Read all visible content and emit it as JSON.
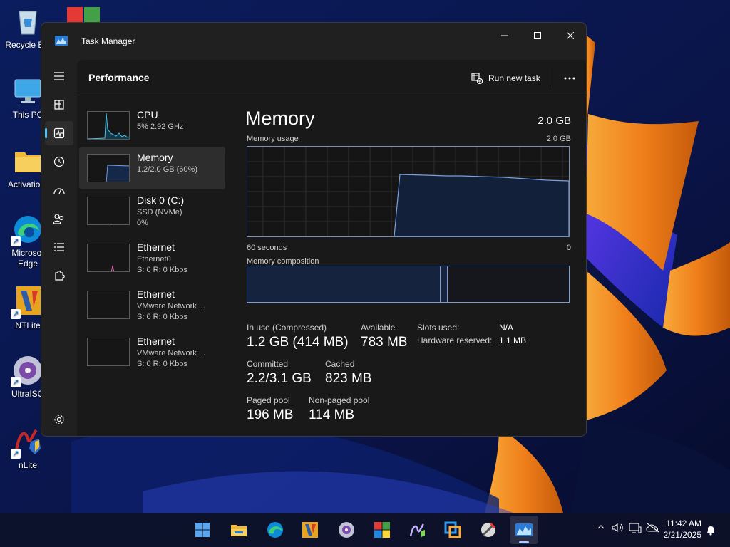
{
  "desktop": {
    "icons": [
      {
        "label": "Recycle Bin",
        "icon": "recycle-bin-icon"
      },
      {
        "label": "This PC",
        "icon": "this-pc-icon"
      },
      {
        "label": "Activation-",
        "icon": "folder-icon"
      },
      {
        "label": "Microsoft Edge",
        "label_line1": "Microsof",
        "label_line2": "Edge",
        "icon": "edge-icon"
      },
      {
        "label": "NTLite",
        "icon": "ntlite-icon"
      },
      {
        "label": "UltraISO",
        "icon": "ultraiso-icon"
      },
      {
        "label": "nLite",
        "icon": "nlite-icon"
      }
    ]
  },
  "window": {
    "title": "Task Manager",
    "page_title": "Performance",
    "run_new_task": "Run new task"
  },
  "nav": [
    {
      "name": "hamburger-menu",
      "icon": "hamburger-icon"
    },
    {
      "name": "processes",
      "icon": "processes-icon"
    },
    {
      "name": "performance",
      "icon": "performance-icon",
      "active": true
    },
    {
      "name": "app-history",
      "icon": "history-icon"
    },
    {
      "name": "startup-apps",
      "icon": "speedometer-icon"
    },
    {
      "name": "users",
      "icon": "users-icon"
    },
    {
      "name": "details",
      "icon": "list-icon"
    },
    {
      "name": "services",
      "icon": "puzzle-icon"
    },
    {
      "name": "settings",
      "icon": "gear-icon"
    }
  ],
  "resources": [
    {
      "name": "CPU",
      "line1": "5%  2.92 GHz",
      "line2": ""
    },
    {
      "name": "Memory",
      "line1": "1.2/2.0 GB (60%)",
      "line2": "",
      "selected": true
    },
    {
      "name": "Disk 0 (C:)",
      "line1": "SSD (NVMe)",
      "line2": "0%"
    },
    {
      "name": "Ethernet",
      "line1": "Ethernet0",
      "line2": "S: 0  R: 0 Kbps"
    },
    {
      "name": "Ethernet",
      "line1": "VMware Network ...",
      "line2": "S: 0  R: 0 Kbps"
    },
    {
      "name": "Ethernet",
      "line1": "VMware Network ...",
      "line2": "S: 0  R: 0 Kbps"
    }
  ],
  "memory": {
    "title": "Memory",
    "total": "2.0 GB",
    "usage_label": "Memory usage",
    "usage_max": "2.0 GB",
    "time_left": "60 seconds",
    "time_right": "0",
    "composition_label": "Memory composition",
    "stats": {
      "in_use_label": "In use (Compressed)",
      "in_use_value": "1.2 GB (414 MB)",
      "available_label": "Available",
      "available_value": "783 MB",
      "slots_label": "Slots used:",
      "slots_value": "N/A",
      "hw_reserved_label": "Hardware reserved:",
      "hw_reserved_value": "1.1 MB",
      "committed_label": "Committed",
      "committed_value": "2.2/3.1 GB",
      "cached_label": "Cached",
      "cached_value": "823 MB",
      "paged_label": "Paged pool",
      "paged_value": "196 MB",
      "nonpaged_label": "Non-paged pool",
      "nonpaged_value": "114 MB"
    }
  },
  "taskbar": {
    "apps": [
      "start-icon",
      "file-explorer-icon",
      "edge-icon",
      "ntlite-icon",
      "ultraiso-icon",
      "windows-icon",
      "nlite-icon",
      "vmware-icon",
      "tool-icon",
      "task-manager-icon"
    ],
    "time": "11:42 AM",
    "date": "2/21/2025"
  },
  "colors": {
    "accent": "#4cc2ff",
    "memory_line": "#7aa0e0"
  }
}
